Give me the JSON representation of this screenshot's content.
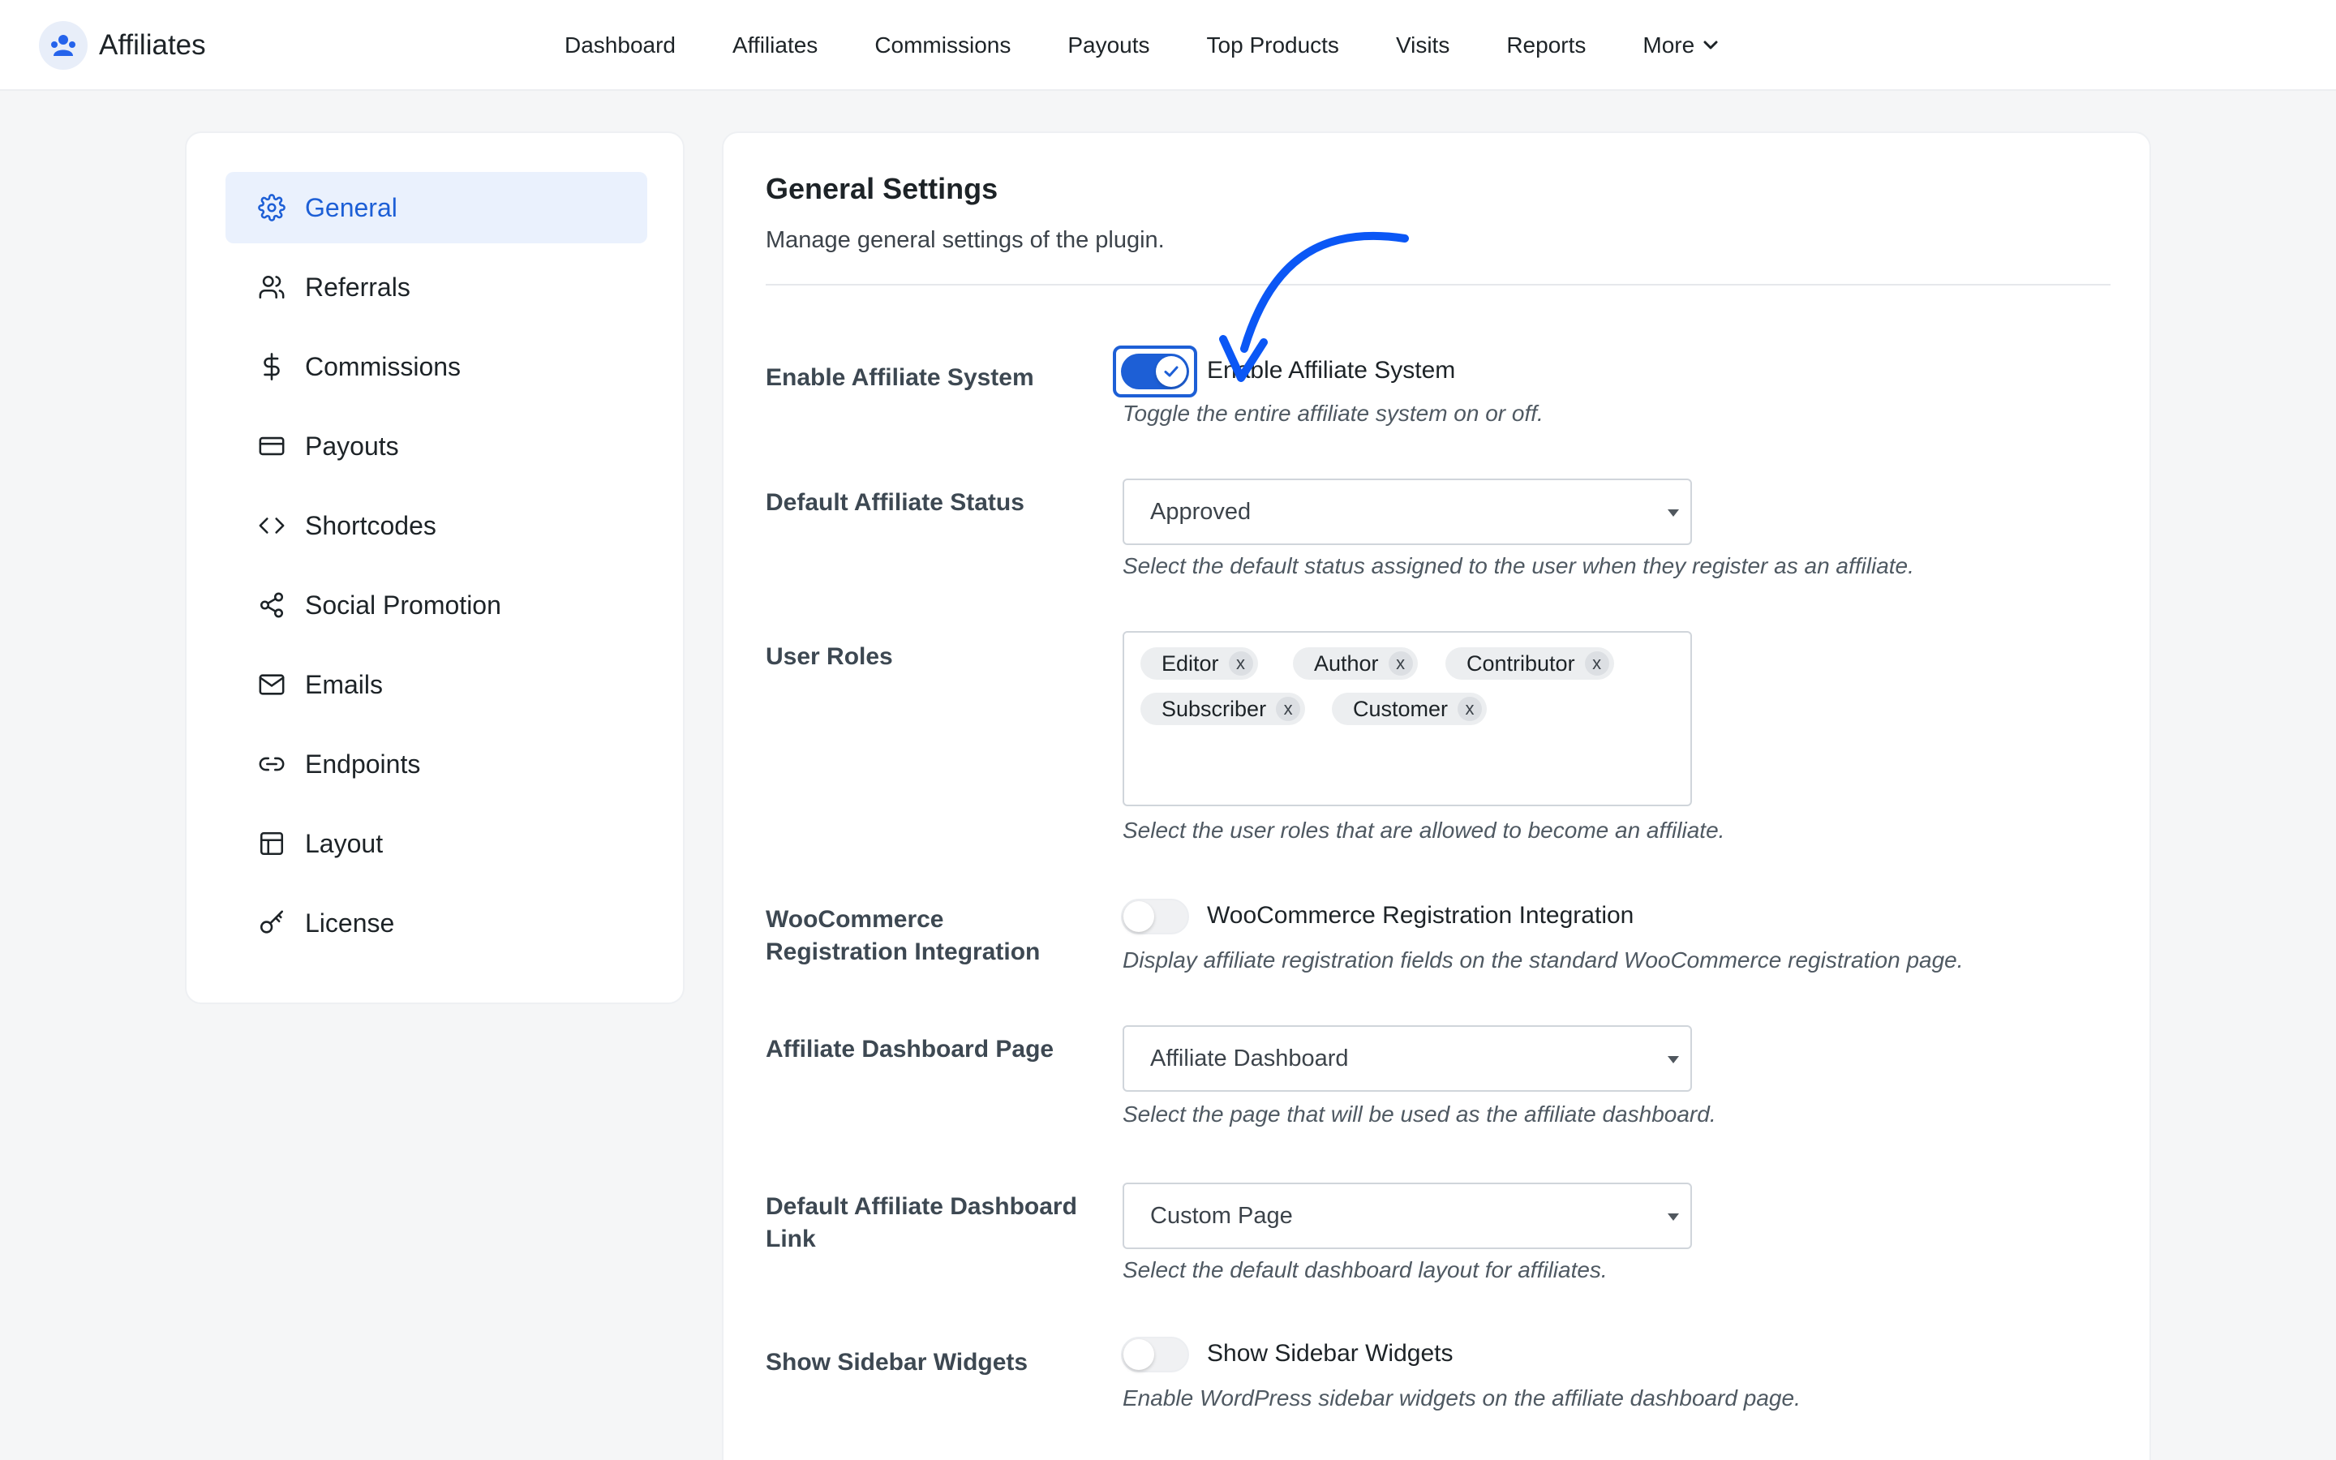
{
  "brand": {
    "name": "Affiliates",
    "logo_icon": "affiliate-logo-icon"
  },
  "topnav": [
    {
      "label": "Dashboard"
    },
    {
      "label": "Affiliates"
    },
    {
      "label": "Commissions"
    },
    {
      "label": "Payouts"
    },
    {
      "label": "Top Products"
    },
    {
      "label": "Visits"
    },
    {
      "label": "Reports"
    },
    {
      "label": "More",
      "icon": "chevron-down-icon"
    }
  ],
  "sidebar": {
    "active_color": "#1d5fd6",
    "items": [
      {
        "label": "General",
        "icon": "gear-icon",
        "active": true
      },
      {
        "label": "Referrals",
        "icon": "users-icon"
      },
      {
        "label": "Commissions",
        "icon": "dollar-icon"
      },
      {
        "label": "Payouts",
        "icon": "credit-card-icon"
      },
      {
        "label": "Shortcodes",
        "icon": "code-icon"
      },
      {
        "label": "Social Promotion",
        "icon": "share-icon"
      },
      {
        "label": "Emails",
        "icon": "mail-icon"
      },
      {
        "label": "Endpoints",
        "icon": "link-icon"
      },
      {
        "label": "Layout",
        "icon": "layout-icon"
      },
      {
        "label": "License",
        "icon": "key-icon"
      }
    ]
  },
  "main": {
    "title": "General Settings",
    "subtitle": "Manage general settings of the plugin.",
    "enable_system": {
      "label": "Enable Affiliate System",
      "toggle_label": "Enable Affiliate System",
      "checked": true,
      "help": "Toggle the entire affiliate system on or off."
    },
    "default_status": {
      "label": "Default Affiliate Status",
      "value": "Approved",
      "help": "Select the default status assigned to the user when they register as an affiliate."
    },
    "user_roles": {
      "label": "User Roles",
      "chips": [
        "Editor",
        "Author",
        "Contributor",
        "Subscriber",
        "Customer"
      ],
      "remove_glyph": "x",
      "help": "Select the user roles that are allowed to become an affiliate."
    },
    "woo_integration": {
      "label": "WooCommerce Registration Integration",
      "toggle_label": "WooCommerce Registration Integration",
      "checked": false,
      "help": "Display affiliate registration fields on the standard WooCommerce registration page."
    },
    "dashboard_page": {
      "label": "Affiliate Dashboard Page",
      "value": "Affiliate Dashboard",
      "help": "Select the page that will be used as the affiliate dashboard."
    },
    "dashboard_link": {
      "label": "Default Affiliate Dashboard Link",
      "value": "Custom Page",
      "help": "Select the default dashboard layout for affiliates."
    },
    "sidebar_widgets": {
      "label": "Show Sidebar Widgets",
      "toggle_label": "Show Sidebar Widgets",
      "checked": false,
      "help": "Enable WordPress sidebar widgets on the affiliate dashboard page."
    }
  },
  "annotation": {
    "color": "#0b57f5",
    "icon": "curved-arrow-icon"
  }
}
